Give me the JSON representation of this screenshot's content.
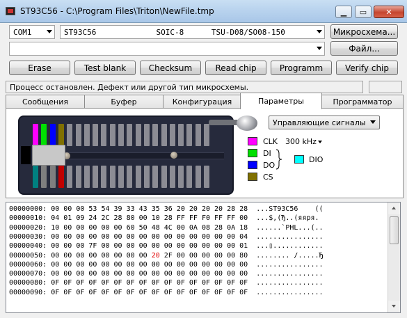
{
  "window": {
    "title": "ST93C56 - C:\\Program Files\\Triton\\NewFile.tmp",
    "minimize_glyph": "▁",
    "maximize_glyph": "▭",
    "close_glyph": "✕"
  },
  "toolbar": {
    "port": "COM1",
    "chip_descriptor": "ST93C56             SOIC-8      TSU-D08/SO08-150",
    "file_path": "",
    "scheme_button": "Микросхема...",
    "file_button": "Файл...",
    "actions": [
      "Erase",
      "Test  blank",
      "Checksum",
      "Read  chip",
      "Programm",
      "Verify  chip"
    ]
  },
  "status": {
    "text": "Процесс остановлен.  Дефект или другой тип микросхемы."
  },
  "tabs": [
    {
      "label": "Сообщения",
      "active": false
    },
    {
      "label": "Буфер",
      "active": false
    },
    {
      "label": "Конфигурация",
      "active": false
    },
    {
      "label": "Параметры",
      "active": true
    },
    {
      "label": "Программатор",
      "active": false
    }
  ],
  "signals": {
    "mode_select": "Управляющие сигналы",
    "frequency": "300 kHz",
    "lines": [
      {
        "label": "CLK",
        "color": "#ff00ff"
      },
      {
        "label": "DI",
        "color": "#00e000"
      },
      {
        "label": "DO",
        "color": "#0000ff"
      },
      {
        "label": "CS",
        "color": "#807000"
      }
    ],
    "output": {
      "label": "DIO",
      "color": "#00ffff"
    },
    "pin_colors": [
      "#ff00ff",
      "#00e000",
      "#0000ff",
      "#807000"
    ]
  },
  "hexdump": {
    "rows": [
      {
        "addr": "00000000:",
        "bytes": "00 00 00 53 54 39 33 43 35 36 20 20 20 20 28 28",
        "ascii": "...ST93C56    (("
      },
      {
        "addr": "00000010:",
        "bytes": "04 01 09 24 2C 28 80 00 10 28 FF FF F0 FF FF 00",
        "ascii": "...$,(Ђ..(яяря."
      },
      {
        "addr": "00000020:",
        "bytes": "10 00 00 00 00 00 60 50 48 4C 00 0A 08 28 0A 18",
        "ascii": "......`PHL...(.."
      },
      {
        "addr": "00000030:",
        "bytes": "00 00 00 00 00 00 00 00 00 00 00 00 00 00 00 04",
        "ascii": "................"
      },
      {
        "addr": "00000040:",
        "bytes": "00 00 00 7F 00 00 00 00 00 00 00 00 00 00 00 01",
        "ascii": "...▯............"
      },
      {
        "addr": "00000050:",
        "bytes_pre": "00 00 00 00 00 00 00 00 ",
        "bytes_red": "20",
        "bytes_post": " 2F 00 00 00 00 00 80",
        "ascii": "........ /.....Ђ"
      },
      {
        "addr": "00000060:",
        "bytes": "00 00 00 00 00 00 00 00 00 00 00 00 00 00 00 00",
        "ascii": "................"
      },
      {
        "addr": "00000070:",
        "bytes": "00 00 00 00 00 00 00 00 00 00 00 00 00 00 00 00",
        "ascii": "................"
      },
      {
        "addr": "00000080:",
        "bytes": "0F 0F 0F 0F 0F 0F 0F 0F 0F 0F 0F 0F 0F 0F 0F 0F",
        "ascii": "................"
      },
      {
        "addr": "00000090:",
        "bytes": "0F 0F 0F 0F 0F 0F 0F 0F 0F 0F 0F 0F 0F 0F 0F 0F",
        "ascii": "................"
      }
    ]
  }
}
